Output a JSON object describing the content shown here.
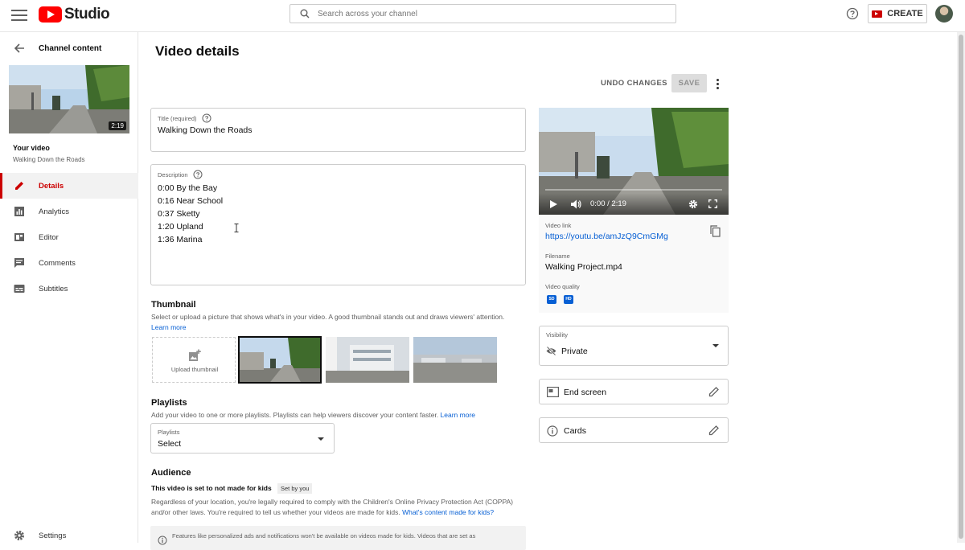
{
  "header": {
    "brand": "Studio",
    "search_placeholder": "Search across your channel",
    "create_label": "CREATE"
  },
  "sidebar": {
    "back_label": "Channel content",
    "thumbnail_duration": "2:19",
    "your_video_label": "Your video",
    "video_title": "Walking Down the Roads",
    "items": [
      {
        "label": "Details",
        "icon": "pencil-icon",
        "active": true
      },
      {
        "label": "Analytics",
        "icon": "analytics-icon",
        "active": false
      },
      {
        "label": "Editor",
        "icon": "editor-icon",
        "active": false
      },
      {
        "label": "Comments",
        "icon": "comments-icon",
        "active": false
      },
      {
        "label": "Subtitles",
        "icon": "subtitles-icon",
        "active": false
      }
    ],
    "settings_label": "Settings"
  },
  "main": {
    "page_title": "Video details",
    "undo_label": "UNDO CHANGES",
    "save_label": "SAVE",
    "title_field": {
      "label": "Title (required)",
      "value": "Walking Down the Roads"
    },
    "description_field": {
      "label": "Description",
      "lines": [
        "0:00 By the Bay",
        "0:16 Near School",
        "0:37 Sketty",
        "1:20 Upland",
        "1:36 Marina"
      ]
    },
    "thumbnail": {
      "title": "Thumbnail",
      "description": "Select or upload a picture that shows what's in your video. A good thumbnail stands out and draws viewers' attention.",
      "learn_more": "Learn more",
      "upload_label": "Upload thumbnail"
    },
    "playlists": {
      "title": "Playlists",
      "description": "Add your video to one or more playlists. Playlists can help viewers discover your content faster.",
      "learn_more": "Learn more",
      "field_label": "Playlists",
      "field_value": "Select"
    },
    "audience": {
      "title": "Audience",
      "status": "This video is set to not made for kids",
      "chip": "Set by you",
      "description": "Regardless of your location, you're legally required to comply with the Children's Online Privacy Protection Act (COPPA) and/or other laws. You're required to tell us whether your videos are made for kids.",
      "link": "What's content made for kids?",
      "notice": "Features like personalized ads and notifications won't be available on videos made for kids. Videos that are set as"
    }
  },
  "right_panel": {
    "player_time": "0:00 / 2:19",
    "video_link_label": "Video link",
    "video_link": "https://youtu.be/amJzQ9CmGMg",
    "filename_label": "Filename",
    "filename": "Walking Project.mp4",
    "quality_label": "Video quality",
    "quality_badges": [
      "SD",
      "HD"
    ],
    "visibility_label": "Visibility",
    "visibility_value": "Private",
    "end_screen_label": "End screen",
    "cards_label": "Cards"
  },
  "colors": {
    "accent": "#cc0000",
    "link": "#065fd4",
    "youtube_red": "#ff0000"
  }
}
